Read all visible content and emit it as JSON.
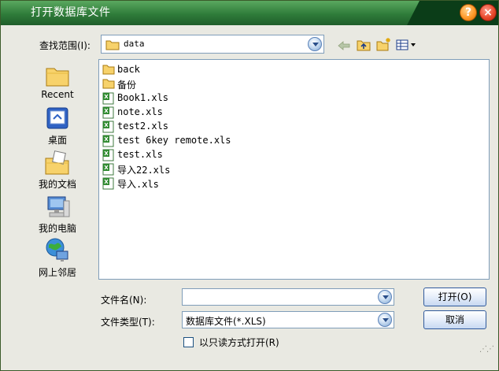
{
  "window": {
    "title": "打开数据库文件",
    "help_label": "?",
    "close_label": "×"
  },
  "lookin": {
    "label": "查找范围(I):",
    "value": "data"
  },
  "toolbar": {
    "icons": [
      "back-arrow-icon",
      "up-folder-icon",
      "new-folder-icon",
      "view-menu-icon"
    ]
  },
  "places": [
    {
      "label": "Recent",
      "icon": "recent-folder-icon"
    },
    {
      "label": "桌面",
      "icon": "desktop-icon"
    },
    {
      "label": "我的文档",
      "icon": "my-documents-icon"
    },
    {
      "label": "我的电脑",
      "icon": "my-computer-icon"
    },
    {
      "label": "网上邻居",
      "icon": "network-icon"
    }
  ],
  "files": [
    {
      "name": "back",
      "type": "folder"
    },
    {
      "name": "备份",
      "type": "folder"
    },
    {
      "name": "Book1.xls",
      "type": "xls"
    },
    {
      "name": "note.xls",
      "type": "xls"
    },
    {
      "name": "test2.xls",
      "type": "xls"
    },
    {
      "name": "test 6key remote.xls",
      "type": "xls"
    },
    {
      "name": "test.xls",
      "type": "xls"
    },
    {
      "name": "导入22.xls",
      "type": "xls"
    },
    {
      "name": "导入.xls",
      "type": "xls"
    }
  ],
  "filename": {
    "label": "文件名(N):",
    "value": ""
  },
  "filetype": {
    "label": "文件类型(T):",
    "value": "数据库文件(*.XLS)"
  },
  "readonly": {
    "label": "以只读方式打开(R)",
    "checked": false
  },
  "buttons": {
    "open": "打开(O)",
    "cancel": "取消"
  },
  "colors": {
    "titlebar": "#2f7c3a",
    "dialog_bg": "#e9e9e2",
    "border": "#7f9db9"
  }
}
